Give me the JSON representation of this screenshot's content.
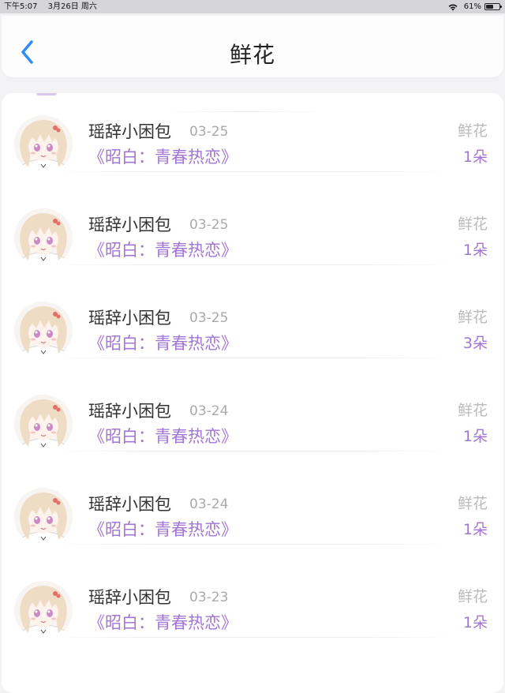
{
  "status_bar": {
    "time": "下午5:07",
    "date": "3月26日 周六",
    "battery_percent": "61%",
    "battery_level": 0.61,
    "wifi_icon": "wifi-icon",
    "battery_icon": "battery-icon"
  },
  "header": {
    "title": "鲜花",
    "back_icon": "chevron-left-icon",
    "accent_color": "#2f8df5"
  },
  "colors": {
    "accent_purple": "#a276d3",
    "muted_gray": "#bbbbbb"
  },
  "records": [
    {
      "user": "瑶辞小困包",
      "date": "03-25",
      "work": "《昭白：青春热恋》",
      "gift": "鲜花",
      "count": "1朵"
    },
    {
      "user": "瑶辞小困包",
      "date": "03-25",
      "work": "《昭白：青春热恋》",
      "gift": "鲜花",
      "count": "1朵"
    },
    {
      "user": "瑶辞小困包",
      "date": "03-25",
      "work": "《昭白：青春热恋》",
      "gift": "鲜花",
      "count": "3朵"
    },
    {
      "user": "瑶辞小困包",
      "date": "03-24",
      "work": "《昭白：青春热恋》",
      "gift": "鲜花",
      "count": "1朵"
    },
    {
      "user": "瑶辞小困包",
      "date": "03-24",
      "work": "《昭白：青春热恋》",
      "gift": "鲜花",
      "count": "1朵"
    },
    {
      "user": "瑶辞小困包",
      "date": "03-23",
      "work": "《昭白：青春热恋》",
      "gift": "鲜花",
      "count": "1朵"
    }
  ]
}
